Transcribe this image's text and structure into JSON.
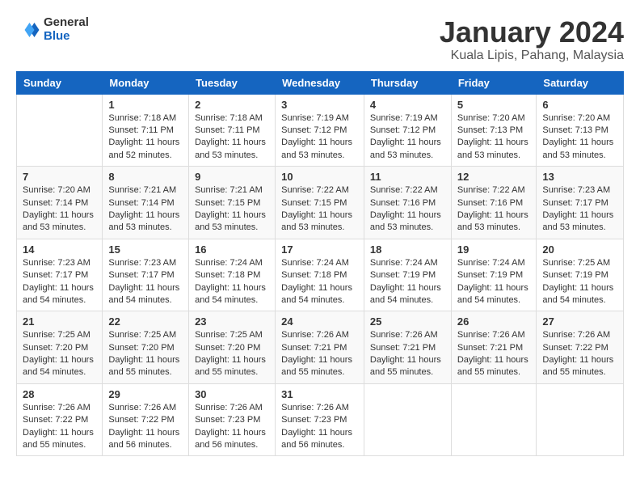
{
  "header": {
    "logo_general": "General",
    "logo_blue": "Blue",
    "month_year": "January 2024",
    "location": "Kuala Lipis, Pahang, Malaysia"
  },
  "calendar": {
    "headers": [
      "Sunday",
      "Monday",
      "Tuesday",
      "Wednesday",
      "Thursday",
      "Friday",
      "Saturday"
    ],
    "weeks": [
      [
        {
          "day": "",
          "info": ""
        },
        {
          "day": "1",
          "info": "Sunrise: 7:18 AM\nSunset: 7:11 PM\nDaylight: 11 hours\nand 52 minutes."
        },
        {
          "day": "2",
          "info": "Sunrise: 7:18 AM\nSunset: 7:11 PM\nDaylight: 11 hours\nand 53 minutes."
        },
        {
          "day": "3",
          "info": "Sunrise: 7:19 AM\nSunset: 7:12 PM\nDaylight: 11 hours\nand 53 minutes."
        },
        {
          "day": "4",
          "info": "Sunrise: 7:19 AM\nSunset: 7:12 PM\nDaylight: 11 hours\nand 53 minutes."
        },
        {
          "day": "5",
          "info": "Sunrise: 7:20 AM\nSunset: 7:13 PM\nDaylight: 11 hours\nand 53 minutes."
        },
        {
          "day": "6",
          "info": "Sunrise: 7:20 AM\nSunset: 7:13 PM\nDaylight: 11 hours\nand 53 minutes."
        }
      ],
      [
        {
          "day": "7",
          "info": "Sunrise: 7:20 AM\nSunset: 7:14 PM\nDaylight: 11 hours\nand 53 minutes."
        },
        {
          "day": "8",
          "info": "Sunrise: 7:21 AM\nSunset: 7:14 PM\nDaylight: 11 hours\nand 53 minutes."
        },
        {
          "day": "9",
          "info": "Sunrise: 7:21 AM\nSunset: 7:15 PM\nDaylight: 11 hours\nand 53 minutes."
        },
        {
          "day": "10",
          "info": "Sunrise: 7:22 AM\nSunset: 7:15 PM\nDaylight: 11 hours\nand 53 minutes."
        },
        {
          "day": "11",
          "info": "Sunrise: 7:22 AM\nSunset: 7:16 PM\nDaylight: 11 hours\nand 53 minutes."
        },
        {
          "day": "12",
          "info": "Sunrise: 7:22 AM\nSunset: 7:16 PM\nDaylight: 11 hours\nand 53 minutes."
        },
        {
          "day": "13",
          "info": "Sunrise: 7:23 AM\nSunset: 7:17 PM\nDaylight: 11 hours\nand 53 minutes."
        }
      ],
      [
        {
          "day": "14",
          "info": "Sunrise: 7:23 AM\nSunset: 7:17 PM\nDaylight: 11 hours\nand 54 minutes."
        },
        {
          "day": "15",
          "info": "Sunrise: 7:23 AM\nSunset: 7:17 PM\nDaylight: 11 hours\nand 54 minutes."
        },
        {
          "day": "16",
          "info": "Sunrise: 7:24 AM\nSunset: 7:18 PM\nDaylight: 11 hours\nand 54 minutes."
        },
        {
          "day": "17",
          "info": "Sunrise: 7:24 AM\nSunset: 7:18 PM\nDaylight: 11 hours\nand 54 minutes."
        },
        {
          "day": "18",
          "info": "Sunrise: 7:24 AM\nSunset: 7:19 PM\nDaylight: 11 hours\nand 54 minutes."
        },
        {
          "day": "19",
          "info": "Sunrise: 7:24 AM\nSunset: 7:19 PM\nDaylight: 11 hours\nand 54 minutes."
        },
        {
          "day": "20",
          "info": "Sunrise: 7:25 AM\nSunset: 7:19 PM\nDaylight: 11 hours\nand 54 minutes."
        }
      ],
      [
        {
          "day": "21",
          "info": "Sunrise: 7:25 AM\nSunset: 7:20 PM\nDaylight: 11 hours\nand 54 minutes."
        },
        {
          "day": "22",
          "info": "Sunrise: 7:25 AM\nSunset: 7:20 PM\nDaylight: 11 hours\nand 55 minutes."
        },
        {
          "day": "23",
          "info": "Sunrise: 7:25 AM\nSunset: 7:20 PM\nDaylight: 11 hours\nand 55 minutes."
        },
        {
          "day": "24",
          "info": "Sunrise: 7:26 AM\nSunset: 7:21 PM\nDaylight: 11 hours\nand 55 minutes."
        },
        {
          "day": "25",
          "info": "Sunrise: 7:26 AM\nSunset: 7:21 PM\nDaylight: 11 hours\nand 55 minutes."
        },
        {
          "day": "26",
          "info": "Sunrise: 7:26 AM\nSunset: 7:21 PM\nDaylight: 11 hours\nand 55 minutes."
        },
        {
          "day": "27",
          "info": "Sunrise: 7:26 AM\nSunset: 7:22 PM\nDaylight: 11 hours\nand 55 minutes."
        }
      ],
      [
        {
          "day": "28",
          "info": "Sunrise: 7:26 AM\nSunset: 7:22 PM\nDaylight: 11 hours\nand 55 minutes."
        },
        {
          "day": "29",
          "info": "Sunrise: 7:26 AM\nSunset: 7:22 PM\nDaylight: 11 hours\nand 56 minutes."
        },
        {
          "day": "30",
          "info": "Sunrise: 7:26 AM\nSunset: 7:23 PM\nDaylight: 11 hours\nand 56 minutes."
        },
        {
          "day": "31",
          "info": "Sunrise: 7:26 AM\nSunset: 7:23 PM\nDaylight: 11 hours\nand 56 minutes."
        },
        {
          "day": "",
          "info": ""
        },
        {
          "day": "",
          "info": ""
        },
        {
          "day": "",
          "info": ""
        }
      ]
    ]
  }
}
